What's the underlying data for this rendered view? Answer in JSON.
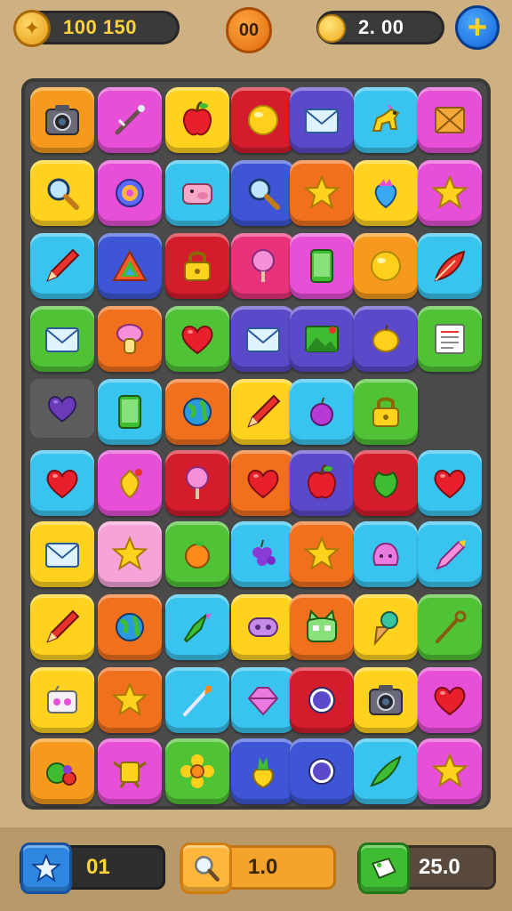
{
  "header": {
    "coins_value": "100 150",
    "center_badge": "00",
    "gems_value": "2.  00",
    "plus_label": "+"
  },
  "board": {
    "rows": [
      [
        {
          "color": "#f59a1c",
          "icon": "camera-icon"
        },
        {
          "color": "#e64fd6",
          "icon": "wand-icon"
        },
        {
          "color": "#ffd21e",
          "icon": "apple-icon"
        },
        {
          "color": "#d41c2c",
          "icon": "ball-icon"
        },
        {
          "color": "#5a49c9",
          "icon": "envelope-icon"
        },
        {
          "color": "#39c4f0",
          "icon": "pony-icon"
        },
        {
          "color": "#e64fd6",
          "icon": "box-icon"
        }
      ],
      [
        {
          "color": "#ffd21e",
          "icon": "magnifier-icon"
        },
        {
          "color": "#e64fd6",
          "icon": "target-icon"
        },
        {
          "color": "#39c4f0",
          "icon": "pig-icon"
        },
        {
          "color": "#3e56d6",
          "icon": "magnifier-icon"
        },
        {
          "color": "#f0701e",
          "icon": "star-icon"
        },
        {
          "color": "#ffd21e",
          "icon": "strawberry-icon"
        },
        {
          "color": "#e64fd6",
          "icon": "star-icon"
        }
      ],
      [
        {
          "color": "#39c4f0",
          "icon": "pencil-icon"
        },
        {
          "color": "#3e56d6",
          "icon": "triangle-icon"
        },
        {
          "color": "#d41c2c",
          "icon": "lock-icon"
        },
        {
          "color": "#e8327a",
          "icon": "cotton-candy-icon"
        },
        {
          "color": "#e64fd6",
          "icon": "tablet-icon"
        },
        {
          "color": "#f59a1c",
          "icon": "ball-icon"
        },
        {
          "color": "#39c4f0",
          "icon": "feather-icon"
        }
      ],
      [
        {
          "color": "#4fc235",
          "icon": "envelope-icon"
        },
        {
          "color": "#f0701e",
          "icon": "mushroom-icon"
        },
        {
          "color": "#4fc235",
          "icon": "heart-icon"
        },
        {
          "color": "#5a49c9",
          "icon": "envelope-icon"
        },
        {
          "color": "#5a49c9",
          "icon": "picture-icon"
        },
        {
          "color": "#5a49c9",
          "icon": "lemon-icon"
        },
        {
          "color": "#4fc235",
          "icon": "note-icon"
        }
      ],
      [
        {
          "color": "#5d5d5d",
          "icon": "heart-icon"
        },
        {
          "color": "#39c4f0",
          "icon": "tablet-icon"
        },
        {
          "color": "#f0701e",
          "icon": "globe-icon"
        },
        {
          "color": "#ffd21e",
          "icon": "pencil-icon"
        },
        {
          "color": "#39c4f0",
          "icon": "plum-icon"
        },
        {
          "color": "#4fc235",
          "icon": "lock-icon"
        },
        null
      ],
      [
        {
          "color": "#39c4f0",
          "icon": "heart-icon"
        },
        {
          "color": "#e64fd6",
          "icon": "cherry-icon"
        },
        {
          "color": "#d41c2c",
          "icon": "cotton-candy-icon"
        },
        {
          "color": "#f0701e",
          "icon": "heart-icon"
        },
        {
          "color": "#5a49c9",
          "icon": "apple-icon"
        },
        {
          "color": "#d41c2c",
          "icon": "leaf-icon"
        },
        {
          "color": "#39c4f0",
          "icon": "heart-icon"
        }
      ],
      [
        {
          "color": "#ffd21e",
          "icon": "envelope-icon"
        },
        {
          "color": "#f5a3d8",
          "icon": "star-icon"
        },
        {
          "color": "#4fc235",
          "icon": "orange-icon"
        },
        {
          "color": "#39c4f0",
          "icon": "grapes-icon"
        },
        {
          "color": "#f0701e",
          "icon": "star-icon"
        },
        {
          "color": "#39c4f0",
          "icon": "blob-icon"
        },
        {
          "color": "#39c4f0",
          "icon": "crayon-icon"
        }
      ],
      [
        {
          "color": "#ffd21e",
          "icon": "pencil-icon"
        },
        {
          "color": "#f0701e",
          "icon": "globe-icon"
        },
        {
          "color": "#39c4f0",
          "icon": "rocket-icon"
        },
        {
          "color": "#ffd21e",
          "icon": "controller-icon"
        },
        {
          "color": "#f0701e",
          "icon": "cat-icon"
        },
        {
          "color": "#ffd21e",
          "icon": "ice-cream-icon"
        },
        {
          "color": "#4fc235",
          "icon": "shovel-icon"
        }
      ],
      [
        {
          "color": "#ffd21e",
          "icon": "radio-icon"
        },
        {
          "color": "#f0701e",
          "icon": "star-icon"
        },
        {
          "color": "#39c4f0",
          "icon": "arrow-icon"
        },
        {
          "color": "#39c4f0",
          "icon": "gem-icon"
        },
        {
          "color": "#d41c2c",
          "icon": "ring-icon"
        },
        {
          "color": "#ffd21e",
          "icon": "camera-icon"
        },
        {
          "color": "#e64fd6",
          "icon": "heart-icon"
        }
      ],
      [
        {
          "color": "#f59a1c",
          "icon": "fruits-icon"
        },
        {
          "color": "#e64fd6",
          "icon": "figure-icon"
        },
        {
          "color": "#4fc235",
          "icon": "flower-icon"
        },
        {
          "color": "#3e56d6",
          "icon": "pineapple-icon"
        },
        {
          "color": "#3e56d6",
          "icon": "ring-icon"
        },
        {
          "color": "#39c4f0",
          "icon": "leaf-arrow-icon"
        },
        {
          "color": "#e64fd6",
          "icon": "star-icon"
        }
      ]
    ]
  },
  "footer": {
    "moves_value": "01",
    "hint_value": "1.0",
    "score_value": "25.0",
    "moves_icon": "star-icon",
    "hint_icon": "magnifier-icon",
    "score_icon": "ticket-icon"
  }
}
